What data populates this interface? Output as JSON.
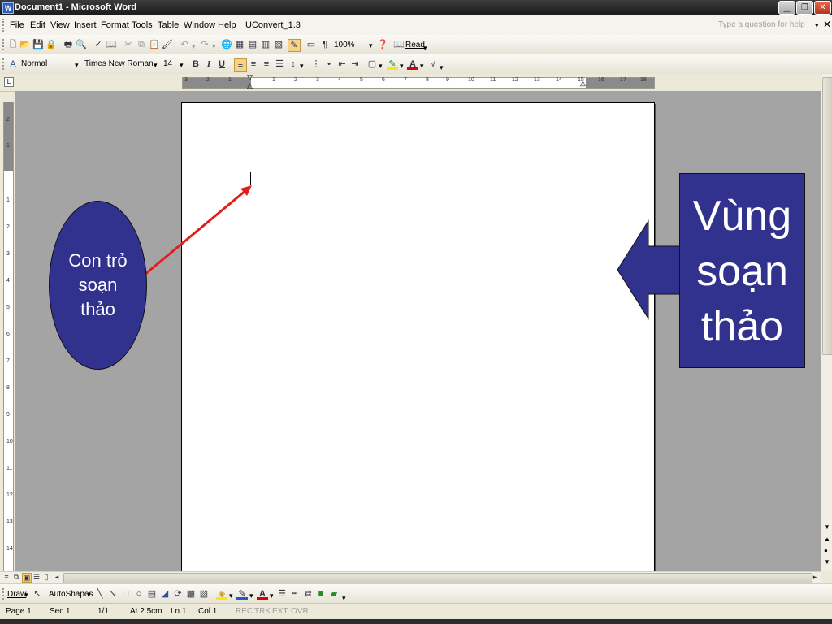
{
  "window": {
    "title": "Document1 - Microsoft Word",
    "app_icon": "W"
  },
  "menu": {
    "items": [
      "File",
      "Edit",
      "View",
      "Insert",
      "Format",
      "Tools",
      "Table",
      "Window",
      "Help",
      "UConvert_1.3"
    ],
    "help_placeholder": "Type a question for help"
  },
  "standard_toolbar": {
    "zoom": "100%",
    "read_label": "Read"
  },
  "formatting_toolbar": {
    "style": "Normal",
    "font": "Times New Roman",
    "size": "14",
    "bold": "B",
    "italic": "I",
    "underline": "U"
  },
  "ruler": {
    "h_labels": [
      "3",
      "2",
      "1",
      "1",
      "2",
      "3",
      "4",
      "5",
      "6",
      "7",
      "8",
      "9",
      "10",
      "11",
      "12",
      "13",
      "14",
      "15",
      "16",
      "17",
      "18"
    ],
    "v_labels": [
      "2",
      "1",
      "1",
      "2",
      "3",
      "4",
      "5",
      "6",
      "7",
      "8",
      "9",
      "10",
      "11",
      "12",
      "13",
      "14"
    ]
  },
  "draw_toolbar": {
    "draw_label": "Draw",
    "autoshapes_label": "AutoShapes"
  },
  "status": {
    "page": "Page 1",
    "sec": "Sec 1",
    "pages": "1/1",
    "at": "At 2.5cm",
    "ln": "Ln 1",
    "col": "Col 1",
    "rec": "REC",
    "trk": "TRK",
    "ext": "EXT",
    "ovr": "OVR"
  },
  "annotations": {
    "cursor_label_lines": [
      "Con trỏ",
      "soạn",
      "thảo"
    ],
    "area_label_lines": [
      "Vùng",
      "soạn",
      "thảo"
    ],
    "oval_color": "#31318e",
    "box_color": "#31318e",
    "arrow_color": "#e31c1c"
  }
}
